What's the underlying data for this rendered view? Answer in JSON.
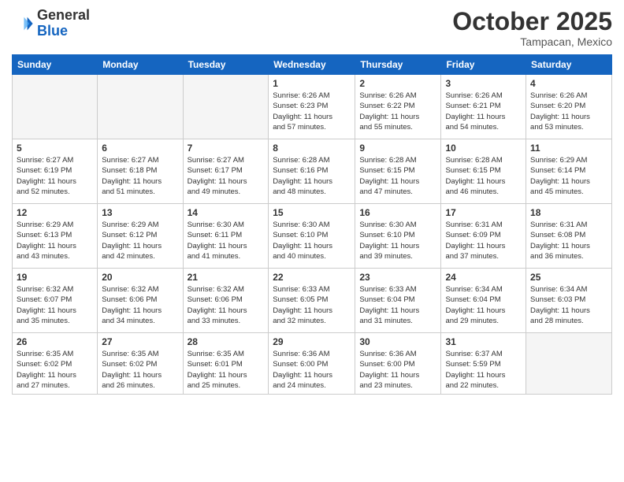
{
  "logo": {
    "general": "General",
    "blue": "Blue"
  },
  "header": {
    "month": "October 2025",
    "location": "Tampacan, Mexico"
  },
  "days_of_week": [
    "Sunday",
    "Monday",
    "Tuesday",
    "Wednesday",
    "Thursday",
    "Friday",
    "Saturday"
  ],
  "weeks": [
    [
      {
        "day": "",
        "info": ""
      },
      {
        "day": "",
        "info": ""
      },
      {
        "day": "",
        "info": ""
      },
      {
        "day": "1",
        "info": "Sunrise: 6:26 AM\nSunset: 6:23 PM\nDaylight: 11 hours\nand 57 minutes."
      },
      {
        "day": "2",
        "info": "Sunrise: 6:26 AM\nSunset: 6:22 PM\nDaylight: 11 hours\nand 55 minutes."
      },
      {
        "day": "3",
        "info": "Sunrise: 6:26 AM\nSunset: 6:21 PM\nDaylight: 11 hours\nand 54 minutes."
      },
      {
        "day": "4",
        "info": "Sunrise: 6:26 AM\nSunset: 6:20 PM\nDaylight: 11 hours\nand 53 minutes."
      }
    ],
    [
      {
        "day": "5",
        "info": "Sunrise: 6:27 AM\nSunset: 6:19 PM\nDaylight: 11 hours\nand 52 minutes."
      },
      {
        "day": "6",
        "info": "Sunrise: 6:27 AM\nSunset: 6:18 PM\nDaylight: 11 hours\nand 51 minutes."
      },
      {
        "day": "7",
        "info": "Sunrise: 6:27 AM\nSunset: 6:17 PM\nDaylight: 11 hours\nand 49 minutes."
      },
      {
        "day": "8",
        "info": "Sunrise: 6:28 AM\nSunset: 6:16 PM\nDaylight: 11 hours\nand 48 minutes."
      },
      {
        "day": "9",
        "info": "Sunrise: 6:28 AM\nSunset: 6:15 PM\nDaylight: 11 hours\nand 47 minutes."
      },
      {
        "day": "10",
        "info": "Sunrise: 6:28 AM\nSunset: 6:15 PM\nDaylight: 11 hours\nand 46 minutes."
      },
      {
        "day": "11",
        "info": "Sunrise: 6:29 AM\nSunset: 6:14 PM\nDaylight: 11 hours\nand 45 minutes."
      }
    ],
    [
      {
        "day": "12",
        "info": "Sunrise: 6:29 AM\nSunset: 6:13 PM\nDaylight: 11 hours\nand 43 minutes."
      },
      {
        "day": "13",
        "info": "Sunrise: 6:29 AM\nSunset: 6:12 PM\nDaylight: 11 hours\nand 42 minutes."
      },
      {
        "day": "14",
        "info": "Sunrise: 6:30 AM\nSunset: 6:11 PM\nDaylight: 11 hours\nand 41 minutes."
      },
      {
        "day": "15",
        "info": "Sunrise: 6:30 AM\nSunset: 6:10 PM\nDaylight: 11 hours\nand 40 minutes."
      },
      {
        "day": "16",
        "info": "Sunrise: 6:30 AM\nSunset: 6:10 PM\nDaylight: 11 hours\nand 39 minutes."
      },
      {
        "day": "17",
        "info": "Sunrise: 6:31 AM\nSunset: 6:09 PM\nDaylight: 11 hours\nand 37 minutes."
      },
      {
        "day": "18",
        "info": "Sunrise: 6:31 AM\nSunset: 6:08 PM\nDaylight: 11 hours\nand 36 minutes."
      }
    ],
    [
      {
        "day": "19",
        "info": "Sunrise: 6:32 AM\nSunset: 6:07 PM\nDaylight: 11 hours\nand 35 minutes."
      },
      {
        "day": "20",
        "info": "Sunrise: 6:32 AM\nSunset: 6:06 PM\nDaylight: 11 hours\nand 34 minutes."
      },
      {
        "day": "21",
        "info": "Sunrise: 6:32 AM\nSunset: 6:06 PM\nDaylight: 11 hours\nand 33 minutes."
      },
      {
        "day": "22",
        "info": "Sunrise: 6:33 AM\nSunset: 6:05 PM\nDaylight: 11 hours\nand 32 minutes."
      },
      {
        "day": "23",
        "info": "Sunrise: 6:33 AM\nSunset: 6:04 PM\nDaylight: 11 hours\nand 31 minutes."
      },
      {
        "day": "24",
        "info": "Sunrise: 6:34 AM\nSunset: 6:04 PM\nDaylight: 11 hours\nand 29 minutes."
      },
      {
        "day": "25",
        "info": "Sunrise: 6:34 AM\nSunset: 6:03 PM\nDaylight: 11 hours\nand 28 minutes."
      }
    ],
    [
      {
        "day": "26",
        "info": "Sunrise: 6:35 AM\nSunset: 6:02 PM\nDaylight: 11 hours\nand 27 minutes."
      },
      {
        "day": "27",
        "info": "Sunrise: 6:35 AM\nSunset: 6:02 PM\nDaylight: 11 hours\nand 26 minutes."
      },
      {
        "day": "28",
        "info": "Sunrise: 6:35 AM\nSunset: 6:01 PM\nDaylight: 11 hours\nand 25 minutes."
      },
      {
        "day": "29",
        "info": "Sunrise: 6:36 AM\nSunset: 6:00 PM\nDaylight: 11 hours\nand 24 minutes."
      },
      {
        "day": "30",
        "info": "Sunrise: 6:36 AM\nSunset: 6:00 PM\nDaylight: 11 hours\nand 23 minutes."
      },
      {
        "day": "31",
        "info": "Sunrise: 6:37 AM\nSunset: 5:59 PM\nDaylight: 11 hours\nand 22 minutes."
      },
      {
        "day": "",
        "info": ""
      }
    ]
  ]
}
